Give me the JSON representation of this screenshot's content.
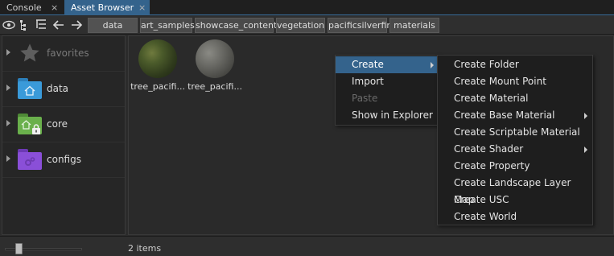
{
  "tabs": [
    {
      "label": "Console",
      "active": false
    },
    {
      "label": "Asset Browser",
      "active": true
    }
  ],
  "tab_close_glyph": "×",
  "toolbar": {
    "icons": [
      "eye-icon",
      "tree-list-icon",
      "tree-expand-icon",
      "back-arrow-icon",
      "forward-arrow-icon"
    ],
    "breadcrumbs": [
      "data",
      "art_samples",
      "showcase_content",
      "vegetation",
      "pacificsilverfir",
      "materials"
    ]
  },
  "sidebar": {
    "items": [
      {
        "label": "favorites",
        "icon": "star-icon"
      },
      {
        "label": "data",
        "icon": "home-folder-icon",
        "color": "#3a9ad9"
      },
      {
        "label": "core",
        "icon": "locked-folder-icon",
        "color": "#6ab04c"
      },
      {
        "label": "configs",
        "icon": "gear-folder-icon",
        "color": "#8a4fd8"
      }
    ]
  },
  "assets": [
    {
      "name": "tree_pacifi..."
    },
    {
      "name": "tree_pacifi..."
    }
  ],
  "status": {
    "item_count": "2 items",
    "zoom_level": 0.2
  },
  "context_menu": {
    "items": [
      {
        "label": "Create",
        "highlight": true,
        "submenu": true
      },
      {
        "label": "Import"
      },
      {
        "label": "Paste",
        "disabled": true
      },
      {
        "label": "Show in Explorer"
      }
    ]
  },
  "create_submenu": {
    "items": [
      {
        "label": "Create Folder"
      },
      {
        "label": "Create Mount Point"
      },
      {
        "label": "Create Material"
      },
      {
        "label": "Create Base Material",
        "submenu": true
      },
      {
        "label": "Create Scriptable Material"
      },
      {
        "label": "Create Shader",
        "submenu": true
      },
      {
        "label": "Create Property"
      },
      {
        "label": "Create Landscape Layer Map"
      },
      {
        "label": "Create USC"
      },
      {
        "label": "Create World"
      }
    ]
  },
  "colors": {
    "accent": "#34638c",
    "data_folder": "#3a9ad9",
    "core_folder": "#6ab04c",
    "configs_folder": "#8a4fd8"
  }
}
